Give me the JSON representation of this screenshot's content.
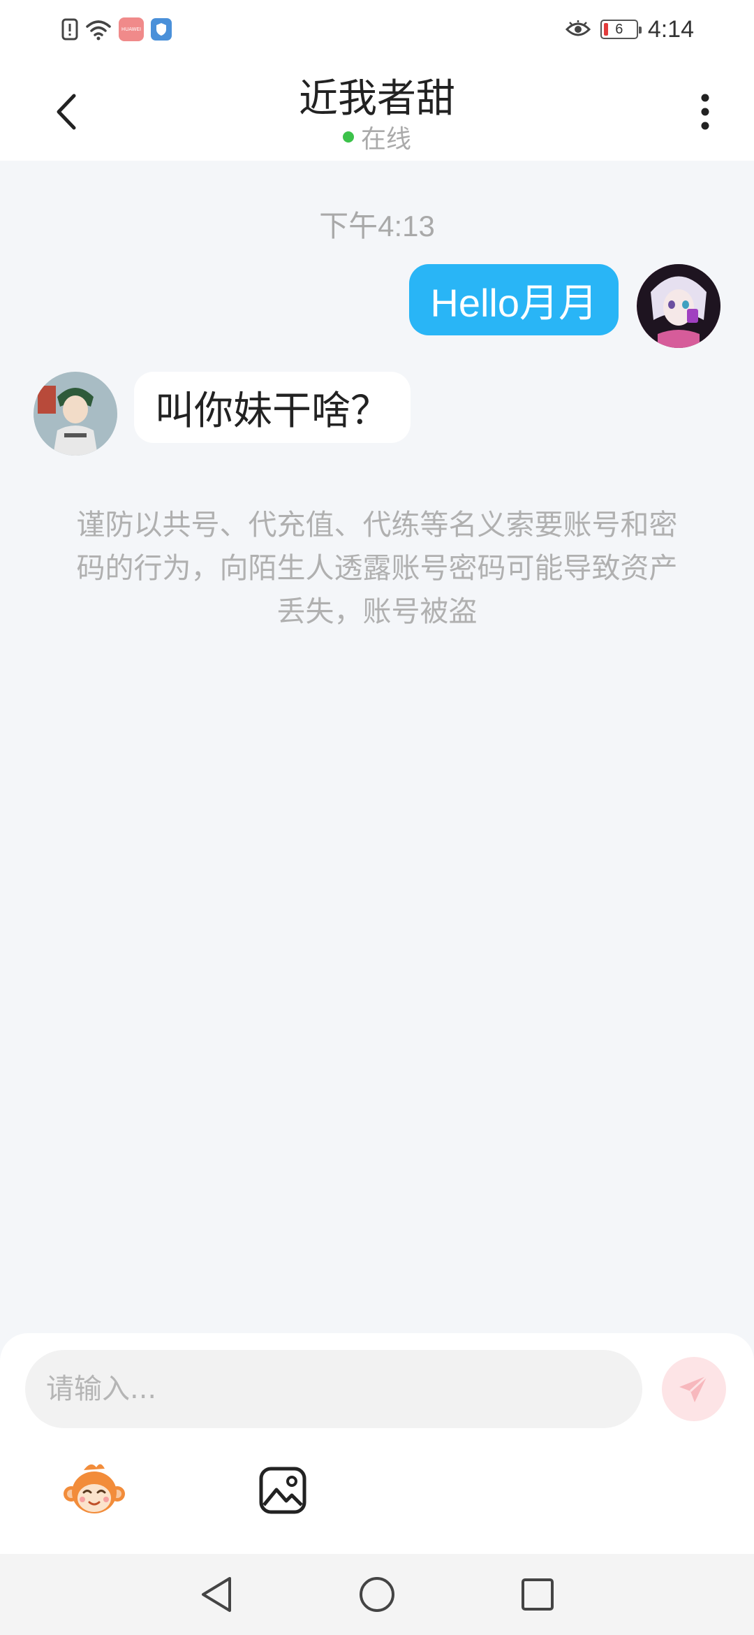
{
  "status_bar": {
    "time": "4:14",
    "battery_level": "6",
    "app_badge_label": "HUAWEI"
  },
  "header": {
    "title": "近我者甜",
    "status": "在线"
  },
  "chat": {
    "timestamp": "下午4:13",
    "messages": [
      {
        "sender": "self",
        "text": "Hello月月"
      },
      {
        "sender": "other",
        "text": "叫你妹干啥？"
      }
    ],
    "notice": "谨防以共号、代充值、代练等名义索要账号和密码的行为，向陌生人透露账号密码可能导致资产丢失，账号被盗"
  },
  "input": {
    "placeholder": "请输入..."
  },
  "colors": {
    "accent_blue": "#29b5f6",
    "online_green": "#3cc24a",
    "send_button_bg": "#fde4e6",
    "background": "#f4f6f9"
  },
  "icons": {
    "back": "chevron-left-icon",
    "more": "more-vertical-icon",
    "send": "paper-plane-icon",
    "emoji": "monkey-emoji-icon",
    "image": "image-icon"
  }
}
